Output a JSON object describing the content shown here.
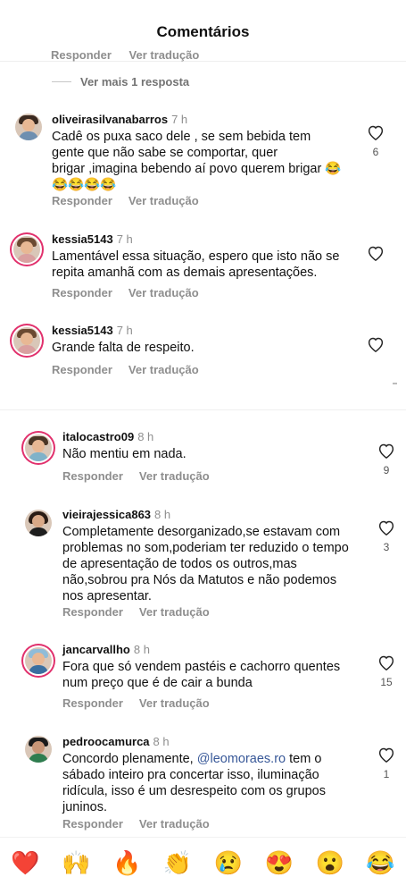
{
  "header": {
    "title": "Comentários"
  },
  "top_cut": {
    "reply": "Responder",
    "translate": "Ver tradução"
  },
  "more_replies": "Ver mais 1 resposta",
  "comments": [
    {
      "user": "oliveirasilvanabarros",
      "time": "7 h",
      "lines": [
        "Cadê os puxa saco dele , se  sem bebida tem",
        "gente que não sabe se comportar,  quer",
        "brigar ,imagina bebendo aí povo querem brigar 😂",
        "😂😂😂😂"
      ],
      "reply": "Responder",
      "translate": "Ver tradução",
      "likes": "6"
    },
    {
      "user": "kessia5143",
      "time": "7 h",
      "lines": [
        "Lamentável essa situação, espero que isto não se",
        "repita amanhã com as demais apresentações."
      ],
      "reply": "Responder",
      "translate": "Ver tradução",
      "likes": ""
    },
    {
      "user": "kessia5143",
      "time": "7 h",
      "lines": [
        "Grande falta de respeito."
      ],
      "reply": "Responder",
      "translate": "Ver tradução",
      "likes": ""
    },
    {
      "user": "italocastro09",
      "time": "8 h",
      "lines": [
        "Não mentiu em nada."
      ],
      "reply": "Responder",
      "translate": "Ver tradução",
      "likes": "9"
    },
    {
      "user": "vieirajessica863",
      "time": "8 h",
      "lines": [
        "Completamente desorganizado,se estavam com",
        "problemas no som,poderiam ter reduzido o tempo",
        "de apresentação de todos os outros,mas",
        "não,sobrou pra Nós da Matutos e não podemos",
        "nos apresentar."
      ],
      "reply": "Responder",
      "translate": "Ver tradução",
      "likes": "3"
    },
    {
      "user": "jancarvallho",
      "time": "8 h",
      "lines": [
        "Fora que só vendem pastéis e cachorro quentes",
        "num preço que é de cair a bunda"
      ],
      "reply": "Responder",
      "translate": "Ver tradução",
      "likes": "15"
    },
    {
      "user": "pedroocamurca",
      "time": "8 h",
      "line1_prefix": "Concordo plenamente, ",
      "mention": "@leomoraes.ro",
      "line1_suffix": " tem o",
      "lines_rest": [
        "sábado inteiro pra concertar isso, iluminação",
        "ridícula, isso é um desrespeito com os grupos",
        "juninos."
      ],
      "reply": "Responder",
      "translate": "Ver tradução",
      "likes": "1"
    }
  ],
  "emoji_bar": [
    "❤️",
    "🙌",
    "🔥",
    "👏",
    "😢",
    "😍",
    "😮",
    "😂"
  ],
  "colors": {
    "mention": "#385898",
    "muted": "#8e8e8e",
    "story_ring": "#e1306c"
  }
}
